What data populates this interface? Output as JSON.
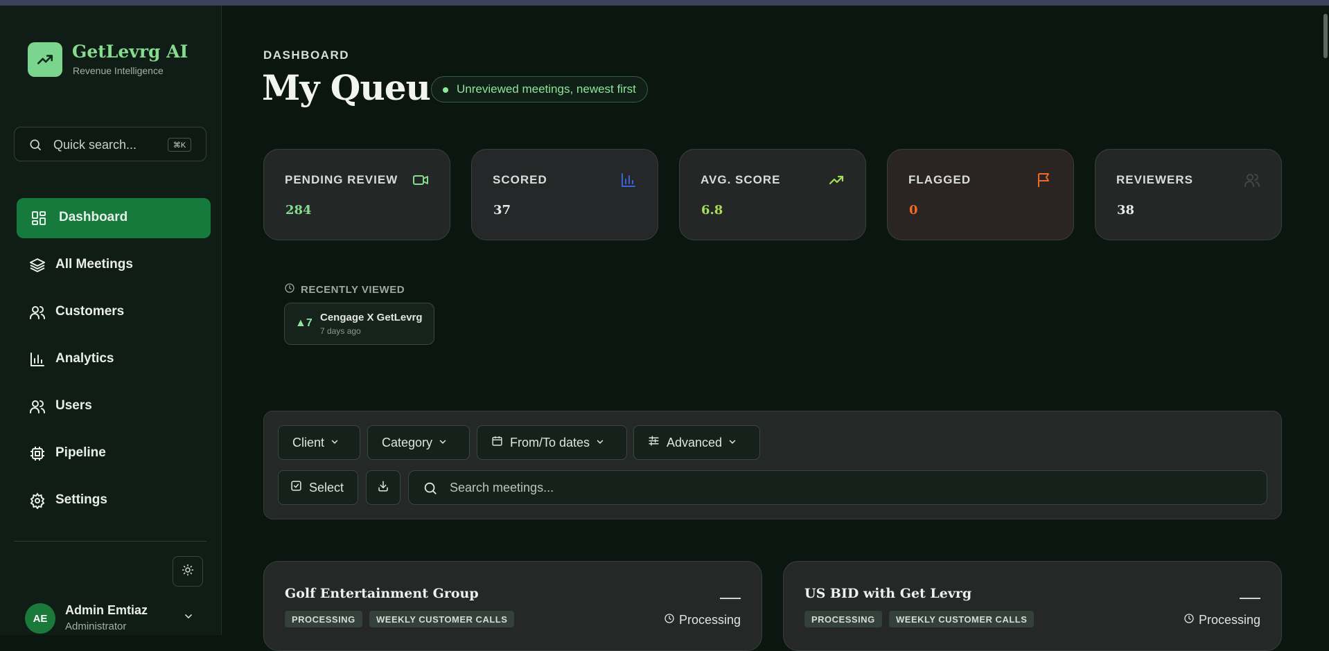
{
  "brand": {
    "name": "GetLevrg AI",
    "subtitle": "Revenue Intelligence"
  },
  "search": {
    "placeholder": "Quick search...",
    "shortcut": "⌘K"
  },
  "nav": [
    {
      "label": "Dashboard",
      "icon": "grid-icon",
      "active": true
    },
    {
      "label": "All Meetings",
      "icon": "layers-icon"
    },
    {
      "label": "Customers",
      "icon": "users-icon"
    },
    {
      "label": "Analytics",
      "icon": "bar-chart-icon"
    },
    {
      "label": "Users",
      "icon": "users-icon"
    },
    {
      "label": "Pipeline",
      "icon": "chip-icon"
    },
    {
      "label": "Settings",
      "icon": "gear-icon"
    }
  ],
  "user": {
    "initials": "AE",
    "name": "Admin Emtiaz",
    "role": "Administrator"
  },
  "header": {
    "breadcrumb": "DASHBOARD",
    "title": "My Queue",
    "status": "Unreviewed meetings, newest first"
  },
  "stats": [
    {
      "title": "PENDING REVIEW",
      "value": "284",
      "icon": "video-icon",
      "color": "#86db8f"
    },
    {
      "title": "SCORED",
      "value": "37",
      "icon": "bar-chart-icon",
      "color": "#3b63e0"
    },
    {
      "title": "AVG. SCORE",
      "value": "6.8",
      "icon": "trending-up-icon",
      "color": "#a6e05a"
    },
    {
      "title": "FLAGGED",
      "value": "0",
      "icon": "flag-icon",
      "color": "#f06a23"
    },
    {
      "title": "REVIEWERS",
      "value": "38",
      "icon": "users-icon",
      "color": "#3f4844"
    }
  ],
  "recent": {
    "label": "RECENTLY VIEWED",
    "items": [
      {
        "score": "▲7",
        "name": "Cengage X GetLevrg",
        "ago": "7 days ago"
      }
    ]
  },
  "filters": {
    "client": "Client",
    "category": "Category",
    "dates": "From/To dates",
    "advanced": "Advanced",
    "select": "Select",
    "search_placeholder": "Search meetings..."
  },
  "meetings": [
    {
      "title": "Golf Entertainment Group",
      "tags": [
        "PROCESSING",
        "WEEKLY CUSTOMER CALLS"
      ],
      "status": "Processing"
    },
    {
      "title": "US BID with Get Levrg",
      "tags": [
        "PROCESSING",
        "WEEKLY CUSTOMER CALLS"
      ],
      "status": "Processing"
    }
  ]
}
